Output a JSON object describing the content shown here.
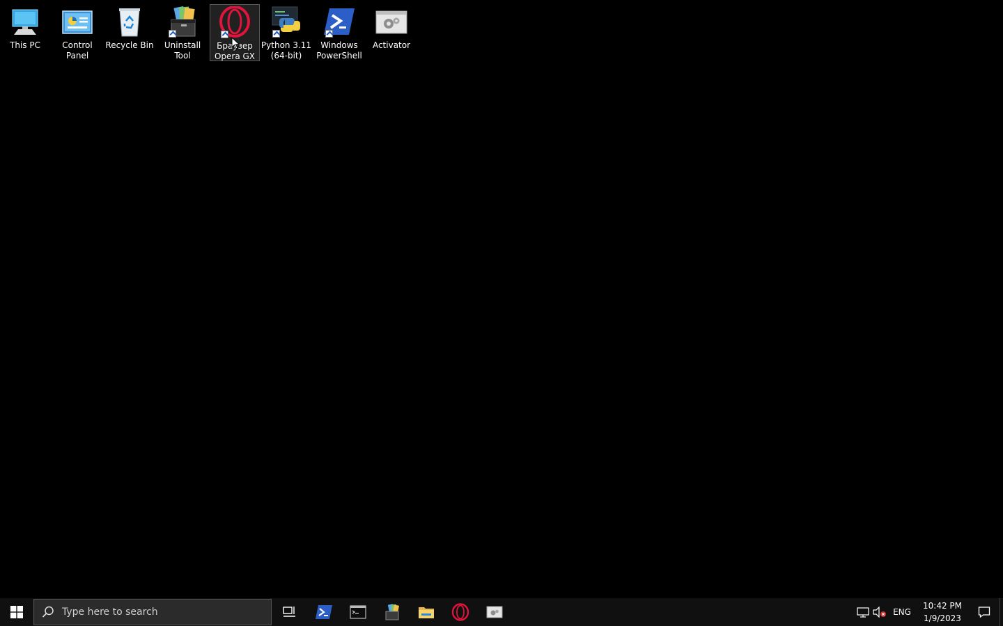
{
  "desktop": {
    "icons": [
      {
        "label": "This PC",
        "icon": "this-pc-icon"
      },
      {
        "label": "Control\nPanel",
        "icon": "control-panel-icon"
      },
      {
        "label": "Recycle Bin",
        "icon": "recycle-bin-icon"
      },
      {
        "label": "Uninstall Tool",
        "icon": "uninstall-tool-icon"
      },
      {
        "label": "Браузер\nOpera GX",
        "icon": "opera-gx-icon"
      },
      {
        "label": "Python 3.11\n(64-bit)",
        "icon": "python-icon"
      },
      {
        "label": "Windows\nPowerShell",
        "icon": "powershell-icon"
      },
      {
        "label": "Activator",
        "icon": "activator-icon"
      }
    ],
    "selected_index": 4
  },
  "taskbar": {
    "search_placeholder": "Type here to search",
    "pinned": [
      "task-view-icon",
      "powershell-icon",
      "terminal-icon",
      "uninstall-tool-icon",
      "file-explorer-icon",
      "opera-gx-icon",
      "activator-icon"
    ],
    "tray": {
      "language": "ENG",
      "time": "10:42 PM",
      "date": "1/9/2023"
    }
  },
  "colors": {
    "background": "#000000",
    "taskbar": "#101010",
    "opera_red": "#e0143c",
    "powershell_blue": "#2b5fc7"
  }
}
